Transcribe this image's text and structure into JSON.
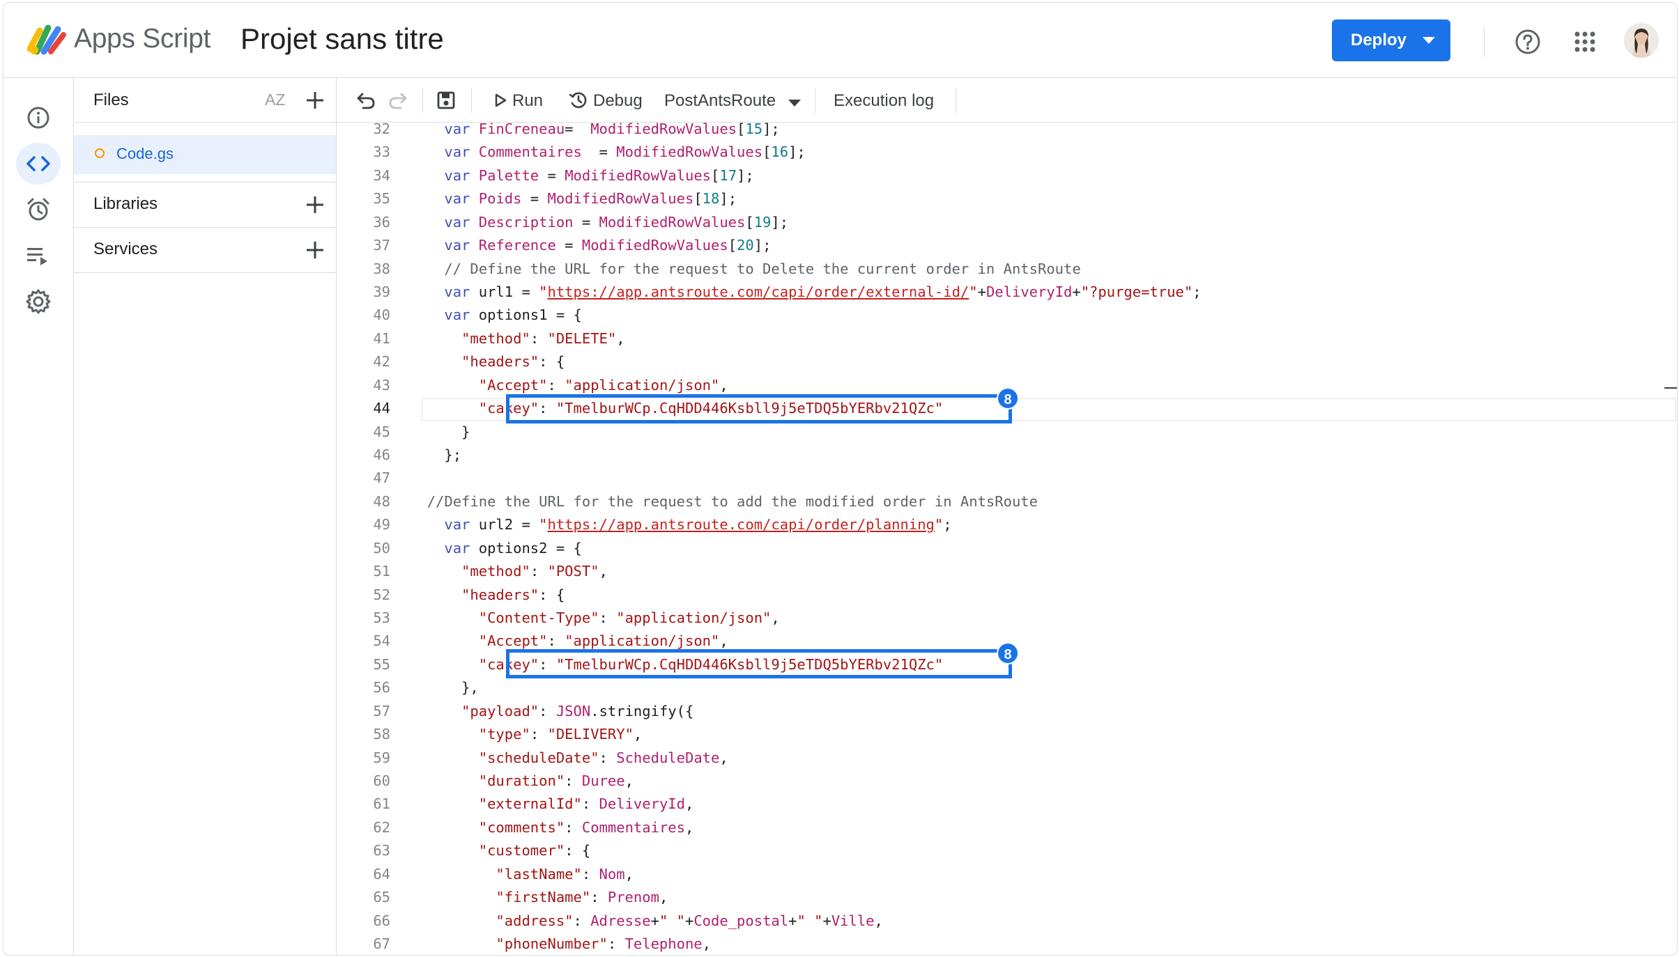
{
  "header": {
    "app_name": "Apps Script",
    "project_title": "Projet sans titre",
    "deploy_label": "Deploy",
    "brand_color": "#1a73e8"
  },
  "rail": {
    "items": [
      {
        "icon": "info-icon",
        "label": "Overview"
      },
      {
        "icon": "code-icon",
        "label": "Editor"
      },
      {
        "icon": "alarm-icon",
        "label": "Triggers"
      },
      {
        "icon": "executions-icon",
        "label": "Executions"
      },
      {
        "icon": "gear-icon",
        "label": "Project Settings"
      }
    ]
  },
  "files_panel": {
    "title": "Files",
    "sort_label": "AZ",
    "files": [
      {
        "name": "Code.gs"
      }
    ],
    "libraries_label": "Libraries",
    "services_label": "Services"
  },
  "toolbar": {
    "run_label": "Run",
    "debug_label": "Debug",
    "function_name": "PostAntsRoute",
    "execution_log_label": "Execution log"
  },
  "highlight_badge": "8",
  "code": {
    "current_line": 44,
    "lines": [
      {
        "n": "32",
        "segs": [
          [
            "    ",
            "p"
          ],
          [
            "var ",
            "k"
          ],
          [
            "FinCreneau",
            "v"
          ],
          [
            "=  ",
            "p"
          ],
          [
            "ModifiedRowValues",
            "v"
          ],
          [
            "[",
            "p"
          ],
          [
            "15",
            "n"
          ],
          [
            "];",
            "p"
          ]
        ]
      },
      {
        "n": "33",
        "segs": [
          [
            "    ",
            "p"
          ],
          [
            "var ",
            "k"
          ],
          [
            "Commentaires",
            "v"
          ],
          [
            "  = ",
            "p"
          ],
          [
            "ModifiedRowValues",
            "v"
          ],
          [
            "[",
            "p"
          ],
          [
            "16",
            "n"
          ],
          [
            "];",
            "p"
          ]
        ]
      },
      {
        "n": "34",
        "segs": [
          [
            "    ",
            "p"
          ],
          [
            "var ",
            "k"
          ],
          [
            "Palette",
            "v"
          ],
          [
            " = ",
            "p"
          ],
          [
            "ModifiedRowValues",
            "v"
          ],
          [
            "[",
            "p"
          ],
          [
            "17",
            "n"
          ],
          [
            "];",
            "p"
          ]
        ]
      },
      {
        "n": "35",
        "segs": [
          [
            "    ",
            "p"
          ],
          [
            "var ",
            "k"
          ],
          [
            "Poids",
            "v"
          ],
          [
            " = ",
            "p"
          ],
          [
            "ModifiedRowValues",
            "v"
          ],
          [
            "[",
            "p"
          ],
          [
            "18",
            "n"
          ],
          [
            "];",
            "p"
          ]
        ]
      },
      {
        "n": "36",
        "segs": [
          [
            "    ",
            "p"
          ],
          [
            "var ",
            "k"
          ],
          [
            "Description",
            "v"
          ],
          [
            " = ",
            "p"
          ],
          [
            "ModifiedRowValues",
            "v"
          ],
          [
            "[",
            "p"
          ],
          [
            "19",
            "n"
          ],
          [
            "];",
            "p"
          ]
        ]
      },
      {
        "n": "37",
        "segs": [
          [
            "    ",
            "p"
          ],
          [
            "var ",
            "k"
          ],
          [
            "Reference",
            "v"
          ],
          [
            " = ",
            "p"
          ],
          [
            "ModifiedRowValues",
            "v"
          ],
          [
            "[",
            "p"
          ],
          [
            "20",
            "n"
          ],
          [
            "];",
            "p"
          ]
        ]
      },
      {
        "n": "38",
        "segs": [
          [
            "    ",
            "p"
          ],
          [
            "// Define the URL for the request to Delete the current order in AntsRoute",
            "c"
          ]
        ]
      },
      {
        "n": "39",
        "segs": [
          [
            "    ",
            "p"
          ],
          [
            "var ",
            "k"
          ],
          [
            "url1 = ",
            "p"
          ],
          [
            "\"",
            "s"
          ],
          [
            "https://app.antsroute.com/capi/order/external-id/",
            "u"
          ],
          [
            "\"",
            "s"
          ],
          [
            "+",
            "p"
          ],
          [
            "DeliveryId",
            "v"
          ],
          [
            "+",
            "p"
          ],
          [
            "\"?purge=true\"",
            "s"
          ],
          [
            ";",
            "p"
          ]
        ]
      },
      {
        "n": "40",
        "segs": [
          [
            "    ",
            "p"
          ],
          [
            "var ",
            "k"
          ],
          [
            "options1 = {",
            "p"
          ]
        ]
      },
      {
        "n": "41",
        "segs": [
          [
            "      ",
            "p"
          ],
          [
            "\"method\"",
            "s"
          ],
          [
            ": ",
            "p"
          ],
          [
            "\"DELETE\"",
            "s"
          ],
          [
            ",",
            "p"
          ]
        ]
      },
      {
        "n": "42",
        "segs": [
          [
            "      ",
            "p"
          ],
          [
            "\"headers\"",
            "s"
          ],
          [
            ": {",
            "p"
          ]
        ]
      },
      {
        "n": "43",
        "segs": [
          [
            "        ",
            "p"
          ],
          [
            "\"Accept\"",
            "s"
          ],
          [
            ": ",
            "p"
          ],
          [
            "\"application/json\"",
            "s"
          ],
          [
            ",",
            "p"
          ]
        ]
      },
      {
        "n": "44",
        "segs": [
          [
            "        ",
            "p"
          ],
          [
            "\"cakey\"",
            "s"
          ],
          [
            ": ",
            "p"
          ],
          [
            "\"TmelburWCp.CqHDD446Ksbll9j5eTDQ5bYERbv21QZc\"",
            "s"
          ]
        ]
      },
      {
        "n": "45",
        "segs": [
          [
            "      }",
            "p"
          ]
        ]
      },
      {
        "n": "46",
        "segs": [
          [
            "    };",
            "p"
          ]
        ]
      },
      {
        "n": "47",
        "segs": [
          [
            "",
            "p"
          ]
        ]
      },
      {
        "n": "48",
        "segs": [
          [
            "  ",
            "p"
          ],
          [
            "//Define the URL for the request to add the modified order in AntsRoute",
            "c"
          ]
        ]
      },
      {
        "n": "49",
        "segs": [
          [
            "    ",
            "p"
          ],
          [
            "var ",
            "k"
          ],
          [
            "url2 = ",
            "p"
          ],
          [
            "\"",
            "s"
          ],
          [
            "https://app.antsroute.com/capi/order/planning",
            "u"
          ],
          [
            "\"",
            "s"
          ],
          [
            ";",
            "p"
          ]
        ]
      },
      {
        "n": "50",
        "segs": [
          [
            "    ",
            "p"
          ],
          [
            "var ",
            "k"
          ],
          [
            "options2 = {",
            "p"
          ]
        ]
      },
      {
        "n": "51",
        "segs": [
          [
            "      ",
            "p"
          ],
          [
            "\"method\"",
            "s"
          ],
          [
            ": ",
            "p"
          ],
          [
            "\"POST\"",
            "s"
          ],
          [
            ",",
            "p"
          ]
        ]
      },
      {
        "n": "52",
        "segs": [
          [
            "      ",
            "p"
          ],
          [
            "\"headers\"",
            "s"
          ],
          [
            ": {",
            "p"
          ]
        ]
      },
      {
        "n": "53",
        "segs": [
          [
            "        ",
            "p"
          ],
          [
            "\"Content-Type\"",
            "s"
          ],
          [
            ": ",
            "p"
          ],
          [
            "\"application/json\"",
            "s"
          ],
          [
            ",",
            "p"
          ]
        ]
      },
      {
        "n": "54",
        "segs": [
          [
            "        ",
            "p"
          ],
          [
            "\"Accept\"",
            "s"
          ],
          [
            ": ",
            "p"
          ],
          [
            "\"application/json\"",
            "s"
          ],
          [
            ",",
            "p"
          ]
        ]
      },
      {
        "n": "55",
        "segs": [
          [
            "        ",
            "p"
          ],
          [
            "\"cakey\"",
            "s"
          ],
          [
            ": ",
            "p"
          ],
          [
            "\"TmelburWCp.CqHDD446Ksbll9j5eTDQ5bYERbv21QZc\"",
            "s"
          ]
        ]
      },
      {
        "n": "56",
        "segs": [
          [
            "      },",
            "p"
          ]
        ]
      },
      {
        "n": "57",
        "segs": [
          [
            "      ",
            "p"
          ],
          [
            "\"payload\"",
            "s"
          ],
          [
            ": ",
            "p"
          ],
          [
            "JSON",
            "v"
          ],
          [
            ".stringify({",
            "p"
          ]
        ]
      },
      {
        "n": "58",
        "segs": [
          [
            "        ",
            "p"
          ],
          [
            "\"type\"",
            "s"
          ],
          [
            ": ",
            "p"
          ],
          [
            "\"DELIVERY\"",
            "s"
          ],
          [
            ",",
            "p"
          ]
        ]
      },
      {
        "n": "59",
        "segs": [
          [
            "        ",
            "p"
          ],
          [
            "\"scheduleDate\"",
            "s"
          ],
          [
            ": ",
            "p"
          ],
          [
            "ScheduleDate",
            "v"
          ],
          [
            ",",
            "p"
          ]
        ]
      },
      {
        "n": "60",
        "segs": [
          [
            "        ",
            "p"
          ],
          [
            "\"duration\"",
            "s"
          ],
          [
            ": ",
            "p"
          ],
          [
            "Duree",
            "v"
          ],
          [
            ",",
            "p"
          ]
        ]
      },
      {
        "n": "61",
        "segs": [
          [
            "        ",
            "p"
          ],
          [
            "\"externalId\"",
            "s"
          ],
          [
            ": ",
            "p"
          ],
          [
            "DeliveryId",
            "v"
          ],
          [
            ",",
            "p"
          ]
        ]
      },
      {
        "n": "62",
        "segs": [
          [
            "        ",
            "p"
          ],
          [
            "\"comments\"",
            "s"
          ],
          [
            ": ",
            "p"
          ],
          [
            "Commentaires",
            "v"
          ],
          [
            ",",
            "p"
          ]
        ]
      },
      {
        "n": "63",
        "segs": [
          [
            "        ",
            "p"
          ],
          [
            "\"customer\"",
            "s"
          ],
          [
            ": {",
            "p"
          ]
        ]
      },
      {
        "n": "64",
        "segs": [
          [
            "          ",
            "p"
          ],
          [
            "\"lastName\"",
            "s"
          ],
          [
            ": ",
            "p"
          ],
          [
            "Nom",
            "v"
          ],
          [
            ",",
            "p"
          ]
        ]
      },
      {
        "n": "65",
        "segs": [
          [
            "          ",
            "p"
          ],
          [
            "\"firstName\"",
            "s"
          ],
          [
            ": ",
            "p"
          ],
          [
            "Prenom",
            "v"
          ],
          [
            ",",
            "p"
          ]
        ]
      },
      {
        "n": "66",
        "segs": [
          [
            "          ",
            "p"
          ],
          [
            "\"address\"",
            "s"
          ],
          [
            ": ",
            "p"
          ],
          [
            "Adresse",
            "v"
          ],
          [
            "+",
            "p"
          ],
          [
            "\" \"",
            "s"
          ],
          [
            "+",
            "p"
          ],
          [
            "Code_postal",
            "v"
          ],
          [
            "+",
            "p"
          ],
          [
            "\" \"",
            "s"
          ],
          [
            "+",
            "p"
          ],
          [
            "Ville",
            "v"
          ],
          [
            ",",
            "p"
          ]
        ]
      },
      {
        "n": "67",
        "segs": [
          [
            "          ",
            "p"
          ],
          [
            "\"phoneNumber\"",
            "s"
          ],
          [
            ": ",
            "p"
          ],
          [
            "Telephone",
            "v"
          ],
          [
            ",",
            "p"
          ]
        ]
      }
    ]
  }
}
